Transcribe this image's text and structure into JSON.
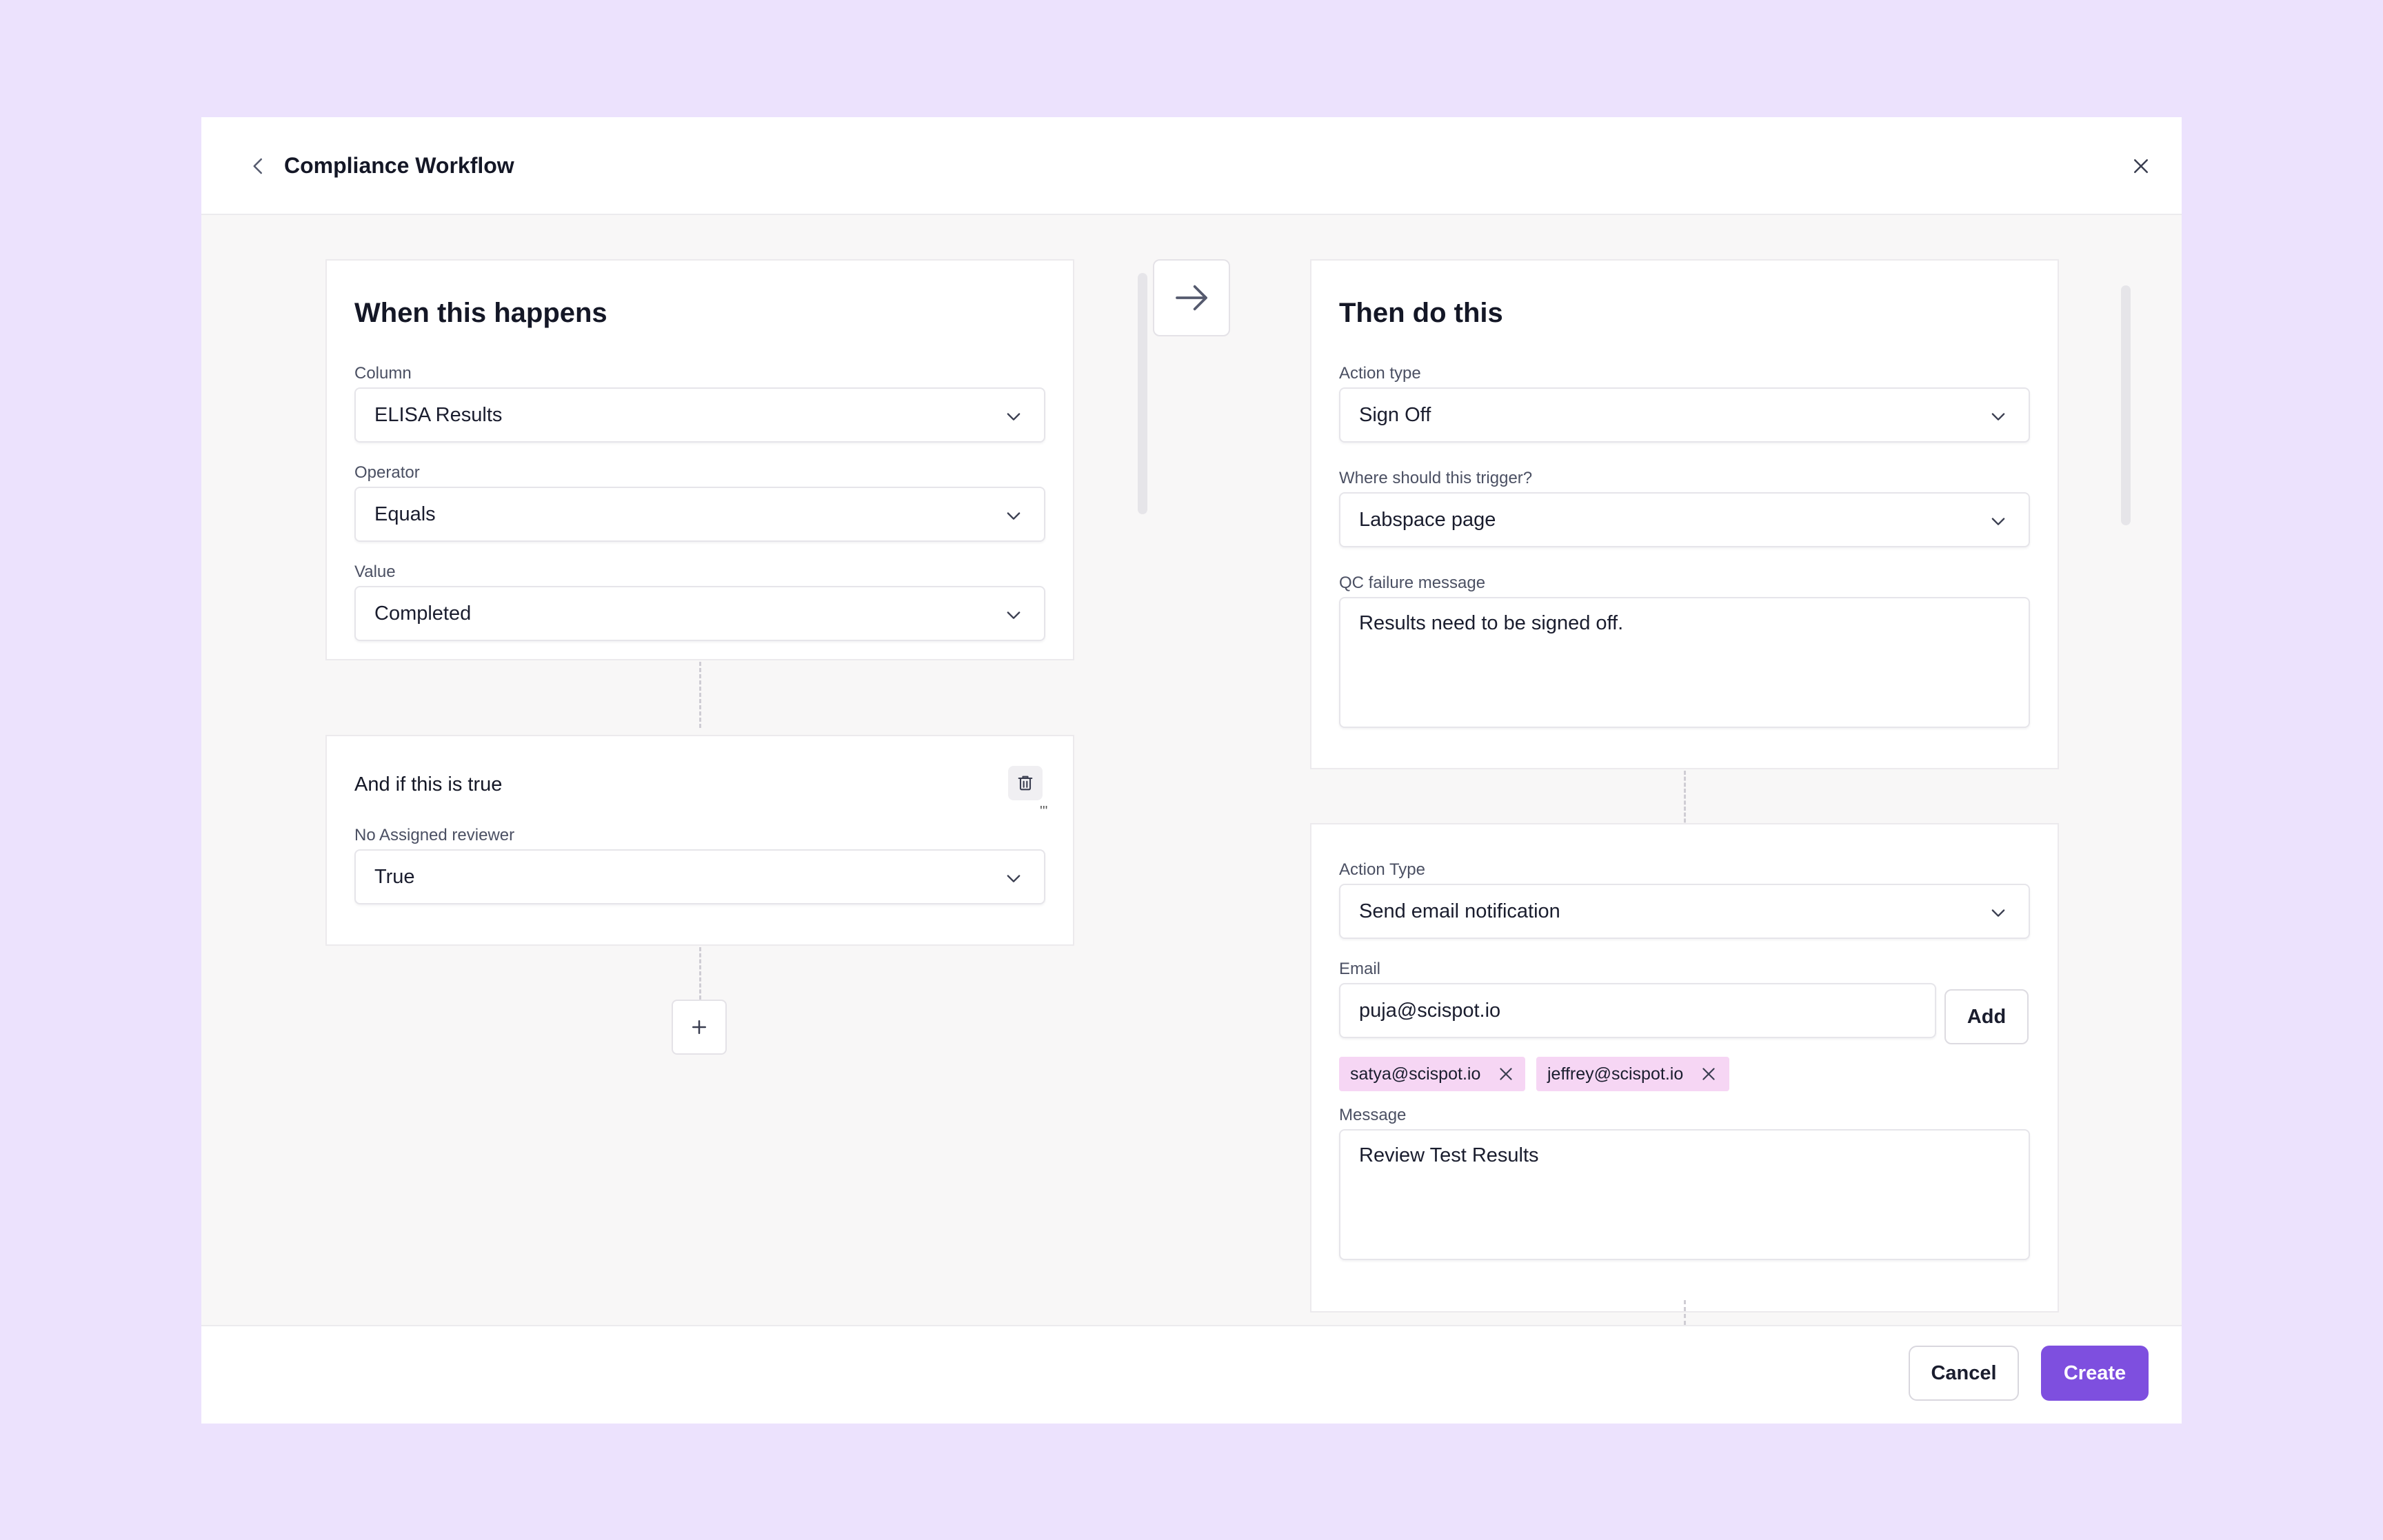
{
  "header": {
    "title": "Compliance Workflow",
    "back_icon": "chevron-left-icon",
    "close_icon": "close-icon"
  },
  "trigger": {
    "heading": "When this happens",
    "column": {
      "label": "Column",
      "value": "ELISA Results"
    },
    "operator": {
      "label": "Operator",
      "value": "Equals"
    },
    "value": {
      "label": "Value",
      "value": "Completed"
    }
  },
  "condition": {
    "heading": "And if this is true",
    "mark": "'''",
    "field": {
      "label": "No Assigned reviewer",
      "value": "True"
    }
  },
  "action1": {
    "heading": "Then do this",
    "action_type": {
      "label": "Action type",
      "value": "Sign Off"
    },
    "trigger_location": {
      "label": "Where should this trigger?",
      "value": "Labspace page"
    },
    "qc_message": {
      "label": "QC failure message",
      "value": "Results need to be signed off."
    }
  },
  "action2": {
    "action_type": {
      "label": "Action Type",
      "value": "Send email notification"
    },
    "email": {
      "label": "Email",
      "value": "puja@scispot.io",
      "add_label": "Add"
    },
    "tags": [
      "satya@scispot.io",
      "jeffrey@scispot.io"
    ],
    "message": {
      "label": "Message",
      "value": "Review Test Results"
    }
  },
  "footer": {
    "cancel_label": "Cancel",
    "create_label": "Create"
  },
  "colors": {
    "page_bg": "#ece2fd",
    "accent": "#7e4fdf",
    "tag_bg": "#f6d6f4"
  }
}
